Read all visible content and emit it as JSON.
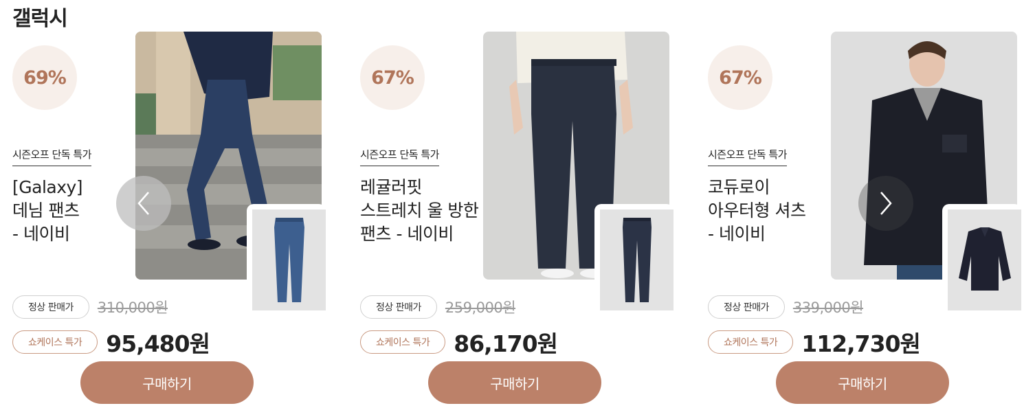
{
  "header": {
    "title": "갤럭시"
  },
  "nav": {
    "prev_icon": "chevron-left-icon",
    "next_icon": "chevron-right-icon"
  },
  "theme": {
    "accent": "#bc8169",
    "badge_bg": "#f7efea",
    "badge_text": "#b0755a"
  },
  "products": [
    {
      "discount": "69%",
      "promo_tag": "시즌오프 단독 특가",
      "name_lines": [
        "[Galaxy]",
        "데님 팬츠",
        "- 네이비"
      ],
      "regular_label": "정상 판매가",
      "regular_price": "310,000원",
      "special_label": "쇼케이스 특가",
      "special_price": "95,480원",
      "buy_label": "구매하기"
    },
    {
      "discount": "67%",
      "promo_tag": "시즌오프 단독 특가",
      "name_lines": [
        "레귤러핏",
        "스트레치 울 방한",
        "팬츠 - 네이비"
      ],
      "regular_label": "정상 판매가",
      "regular_price": "259,000원",
      "special_label": "쇼케이스 특가",
      "special_price": "86,170원",
      "buy_label": "구매하기"
    },
    {
      "discount": "67%",
      "promo_tag": "시즌오프 단독 특가",
      "name_lines": [
        "코듀로이",
        "아우터형 셔츠",
        "- 네이비"
      ],
      "regular_label": "정상 판매가",
      "regular_price": "339,000원",
      "special_label": "쇼케이스 특가",
      "special_price": "112,730원",
      "buy_label": "구매하기"
    }
  ]
}
